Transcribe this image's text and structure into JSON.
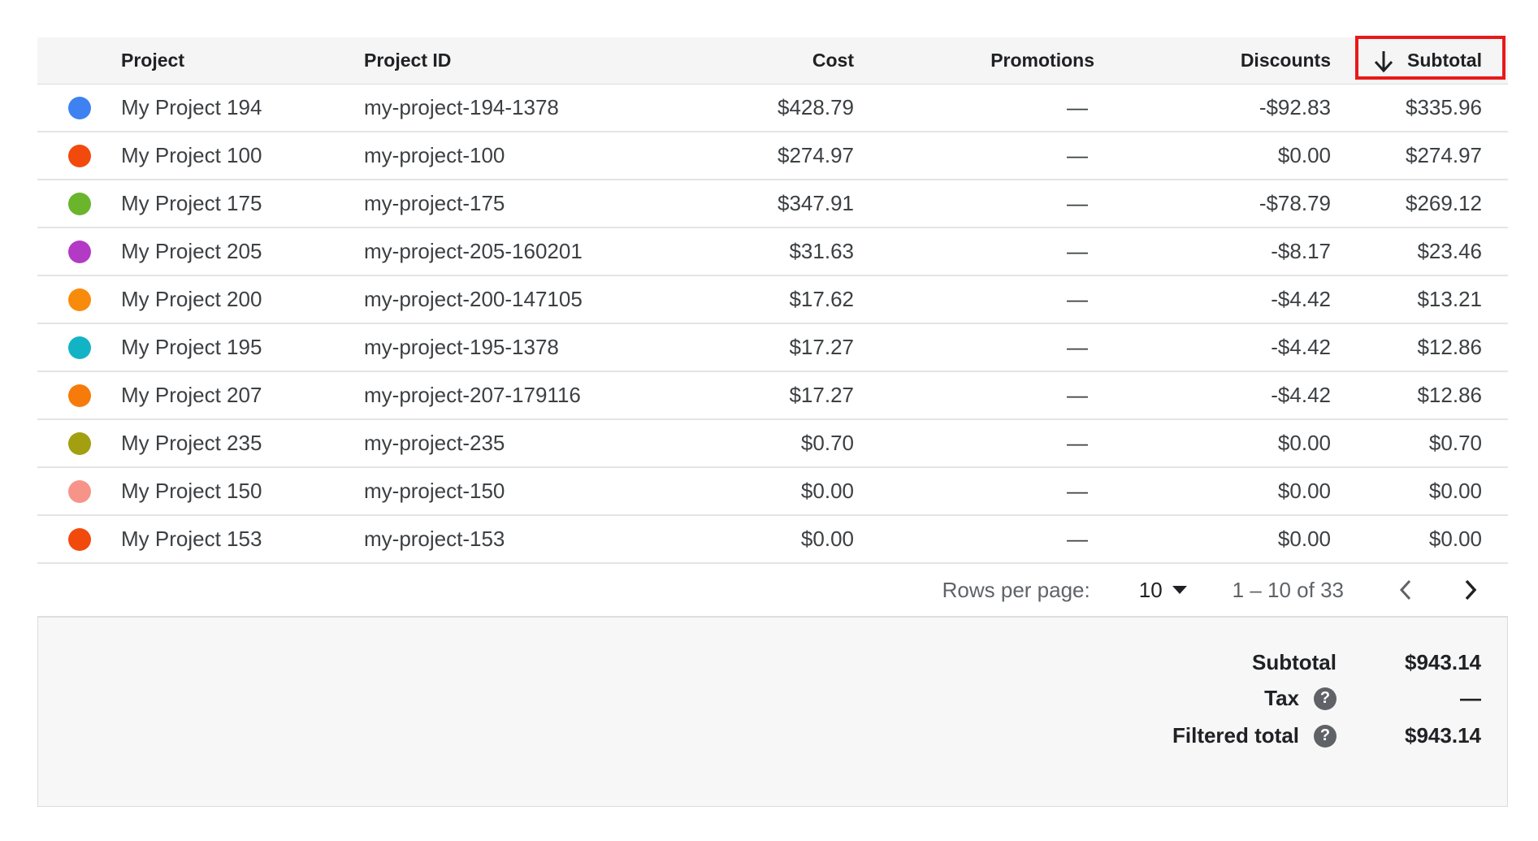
{
  "table": {
    "columns": {
      "project": "Project",
      "project_id": "Project ID",
      "cost": "Cost",
      "promotions": "Promotions",
      "discounts": "Discounts",
      "subtotal": "Subtotal"
    },
    "sort": {
      "column": "subtotal",
      "direction": "descending",
      "icon": "arrow-down-icon"
    },
    "rows": [
      {
        "color": "#3d82f0",
        "project": "My Project 194",
        "project_id": "my-project-194-1378",
        "cost": "$428.79",
        "promotions": "—",
        "discounts": "-$92.83",
        "subtotal": "$335.96"
      },
      {
        "color": "#f24a0d",
        "project": "My Project 100",
        "project_id": "my-project-100",
        "cost": "$274.97",
        "promotions": "—",
        "discounts": "$0.00",
        "subtotal": "$274.97"
      },
      {
        "color": "#6bb52d",
        "project": "My Project 175",
        "project_id": "my-project-175",
        "cost": "$347.91",
        "promotions": "—",
        "discounts": "-$78.79",
        "subtotal": "$269.12"
      },
      {
        "color": "#b33ac4",
        "project": "My Project 205",
        "project_id": "my-project-205-160201",
        "cost": "$31.63",
        "promotions": "—",
        "discounts": "-$8.17",
        "subtotal": "$23.46"
      },
      {
        "color": "#f98b0c",
        "project": "My Project 200",
        "project_id": "my-project-200-147105",
        "cost": "$17.62",
        "promotions": "—",
        "discounts": "-$4.42",
        "subtotal": "$13.21"
      },
      {
        "color": "#13b3c6",
        "project": "My Project 195",
        "project_id": "my-project-195-1378",
        "cost": "$17.27",
        "promotions": "—",
        "discounts": "-$4.42",
        "subtotal": "$12.86"
      },
      {
        "color": "#f77b0b",
        "project": "My Project 207",
        "project_id": "my-project-207-179116",
        "cost": "$17.27",
        "promotions": "—",
        "discounts": "-$4.42",
        "subtotal": "$12.86"
      },
      {
        "color": "#a2a011",
        "project": "My Project 235",
        "project_id": "my-project-235",
        "cost": "$0.70",
        "promotions": "—",
        "discounts": "$0.00",
        "subtotal": "$0.70"
      },
      {
        "color": "#f7948a",
        "project": "My Project 150",
        "project_id": "my-project-150",
        "cost": "$0.00",
        "promotions": "—",
        "discounts": "$0.00",
        "subtotal": "$0.00"
      },
      {
        "color": "#f24a0d",
        "project": "My Project 153",
        "project_id": "my-project-153",
        "cost": "$0.00",
        "promotions": "—",
        "discounts": "$0.00",
        "subtotal": "$0.00"
      }
    ]
  },
  "pagination": {
    "rows_per_page_label": "Rows per page:",
    "rows_per_page_value": "10",
    "range": "1 – 10 of 33",
    "prev_icon": "chevron-left-icon",
    "next_icon": "chevron-right-icon"
  },
  "summary": {
    "subtotal_label": "Subtotal",
    "subtotal_value": "$943.14",
    "tax_label": "Tax",
    "tax_value": "—",
    "filtered_total_label": "Filtered total",
    "filtered_total_value": "$943.14",
    "help_icon_glyph": "?"
  },
  "colors": {
    "highlight": "#e8191a",
    "header_bg": "#f5f5f5",
    "summary_bg": "#f7f7f7"
  }
}
